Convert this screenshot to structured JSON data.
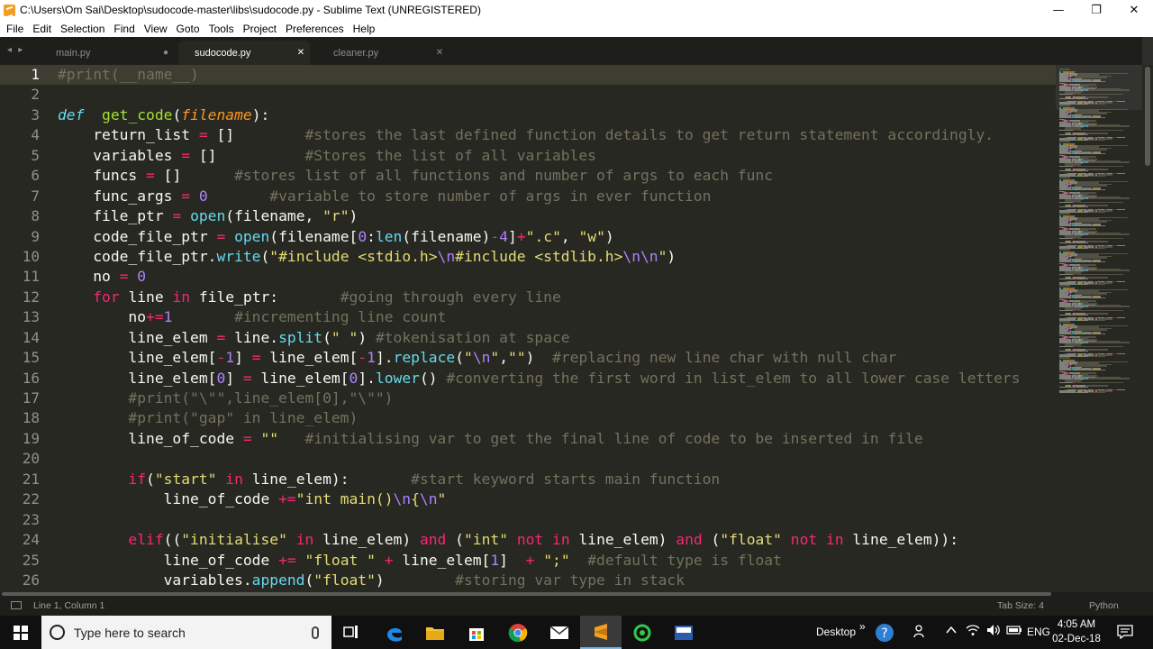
{
  "window": {
    "title": "C:\\Users\\Om Sai\\Desktop\\sudocode-master\\libs\\sudocode.py - Sublime Text (UNREGISTERED)",
    "controls": [
      "—",
      "❐",
      "✕"
    ]
  },
  "menu": [
    "File",
    "Edit",
    "Selection",
    "Find",
    "View",
    "Goto",
    "Tools",
    "Project",
    "Preferences",
    "Help"
  ],
  "tabs": [
    {
      "label": "main.py",
      "control": "●",
      "active": false
    },
    {
      "label": "sudocode.py",
      "control": "✕",
      "active": true
    },
    {
      "label": "cleaner.py",
      "control": "✕",
      "active": false
    }
  ],
  "tab_nav": "◂ ▸",
  "editor": {
    "line_numbers": [
      "1",
      "2",
      "3",
      "4",
      "5",
      "6",
      "7",
      "8",
      "9",
      "10",
      "11",
      "12",
      "13",
      "14",
      "15",
      "16",
      "17",
      "18",
      "19",
      "20",
      "21",
      "22",
      "23",
      "24",
      "25",
      "26"
    ],
    "current_line": 1,
    "lines": [
      [
        [
          "cm",
          "#print(__name__)"
        ]
      ],
      [],
      [
        [
          "kd",
          "def"
        ],
        [
          "",
          "  "
        ],
        [
          "fn",
          "get_code"
        ],
        [
          "",
          "("
        ],
        [
          "pm",
          "filename"
        ],
        [
          "",
          "):"
        ]
      ],
      [
        [
          "",
          "    return_list "
        ],
        [
          "kw",
          "="
        ],
        [
          "",
          " []        "
        ],
        [
          "cm",
          "#stores the last defined function details to get return statement accordingly."
        ]
      ],
      [
        [
          "",
          "    variables "
        ],
        [
          "kw",
          "="
        ],
        [
          "",
          " []          "
        ],
        [
          "cm",
          "#Stores the list of all variables"
        ]
      ],
      [
        [
          "",
          "    funcs "
        ],
        [
          "kw",
          "="
        ],
        [
          "",
          " []      "
        ],
        [
          "cm",
          "#stores list of all functions and number of args to each func"
        ]
      ],
      [
        [
          "",
          "    func_args "
        ],
        [
          "kw",
          "="
        ],
        [
          "",
          " "
        ],
        [
          "nm",
          "0"
        ],
        [
          "",
          "       "
        ],
        [
          "cm",
          "#variable to store number of args in ever function"
        ]
      ],
      [
        [
          "",
          "    file_ptr "
        ],
        [
          "kw",
          "="
        ],
        [
          "",
          " "
        ],
        [
          "bi",
          "open"
        ],
        [
          "",
          "(filename, "
        ],
        [
          "st",
          "\"r\""
        ],
        [
          "",
          ")"
        ]
      ],
      [
        [
          "",
          "    code_file_ptr "
        ],
        [
          "kw",
          "="
        ],
        [
          "",
          " "
        ],
        [
          "bi",
          "open"
        ],
        [
          "",
          "(filename["
        ],
        [
          "nm",
          "0"
        ],
        [
          "",
          ":"
        ],
        [
          "bi",
          "len"
        ],
        [
          "",
          "(filename)"
        ],
        [
          "kw",
          "-"
        ],
        [
          "nm",
          "4"
        ],
        [
          "",
          "]"
        ],
        [
          "kw",
          "+"
        ],
        [
          "st",
          "\".c\""
        ],
        [
          "",
          ", "
        ],
        [
          "st",
          "\"w\""
        ],
        [
          "",
          ")"
        ]
      ],
      [
        [
          "",
          "    code_file_ptr."
        ],
        [
          "bi",
          "write"
        ],
        [
          "",
          "("
        ],
        [
          "st",
          "\"#include <stdio.h>"
        ],
        [
          "es",
          "\\n"
        ],
        [
          "st",
          "#include <stdlib.h>"
        ],
        [
          "es",
          "\\n\\n"
        ],
        [
          "st",
          "\""
        ],
        [
          "",
          ")"
        ]
      ],
      [
        [
          "",
          "    no "
        ],
        [
          "kw",
          "="
        ],
        [
          "",
          " "
        ],
        [
          "nm",
          "0"
        ]
      ],
      [
        [
          "",
          "    "
        ],
        [
          "kw",
          "for"
        ],
        [
          "",
          " line "
        ],
        [
          "kw",
          "in"
        ],
        [
          "",
          " file_ptr:       "
        ],
        [
          "cm",
          "#going through every line"
        ]
      ],
      [
        [
          "",
          "        no"
        ],
        [
          "kw",
          "+="
        ],
        [
          "nm",
          "1"
        ],
        [
          "",
          "       "
        ],
        [
          "cm",
          "#incrementing line count"
        ]
      ],
      [
        [
          "",
          "        line_elem "
        ],
        [
          "kw",
          "="
        ],
        [
          "",
          " line."
        ],
        [
          "bi",
          "split"
        ],
        [
          "",
          "("
        ],
        [
          "st",
          "\" \""
        ],
        [
          "",
          ") "
        ],
        [
          "cm",
          "#tokenisation at space"
        ]
      ],
      [
        [
          "",
          "        line_elem["
        ],
        [
          "kw",
          "-"
        ],
        [
          "nm",
          "1"
        ],
        [
          "",
          "] "
        ],
        [
          "kw",
          "="
        ],
        [
          "",
          " line_elem["
        ],
        [
          "kw",
          "-"
        ],
        [
          "nm",
          "1"
        ],
        [
          "",
          "]."
        ],
        [
          "bi",
          "replace"
        ],
        [
          "",
          "("
        ],
        [
          "st",
          "\""
        ],
        [
          "es",
          "\\n"
        ],
        [
          "st",
          "\""
        ],
        [
          "",
          ","
        ],
        [
          "st",
          "\"\""
        ],
        [
          "",
          ")  "
        ],
        [
          "cm",
          "#replacing new line char with null char"
        ]
      ],
      [
        [
          "",
          "        line_elem["
        ],
        [
          "nm",
          "0"
        ],
        [
          "",
          "] "
        ],
        [
          "kw",
          "="
        ],
        [
          "",
          " line_elem["
        ],
        [
          "nm",
          "0"
        ],
        [
          "",
          "]."
        ],
        [
          "bi",
          "lower"
        ],
        [
          "",
          "() "
        ],
        [
          "cm",
          "#converting the first word in list_elem to all lower case letters"
        ]
      ],
      [
        [
          "",
          "        "
        ],
        [
          "cm",
          "#print(\"\\\"\",line_elem[0],\"\\\"\")"
        ]
      ],
      [
        [
          "",
          "        "
        ],
        [
          "cm",
          "#print(\"gap\" in line_elem)"
        ]
      ],
      [
        [
          "",
          "        line_of_code "
        ],
        [
          "kw",
          "="
        ],
        [
          "",
          " "
        ],
        [
          "st",
          "\"\""
        ],
        [
          "",
          "   "
        ],
        [
          "cm",
          "#initialising var to get the final line of code to be inserted in file"
        ]
      ],
      [],
      [
        [
          "",
          "        "
        ],
        [
          "kw",
          "if"
        ],
        [
          "",
          "("
        ],
        [
          "st",
          "\"start\""
        ],
        [
          "",
          " "
        ],
        [
          "kw",
          "in"
        ],
        [
          "",
          " line_elem):       "
        ],
        [
          "cm",
          "#start keyword starts main function"
        ]
      ],
      [
        [
          "",
          "            line_of_code "
        ],
        [
          "kw",
          "+="
        ],
        [
          "st",
          "\"int main()"
        ],
        [
          "es",
          "\\n"
        ],
        [
          "st",
          "{"
        ],
        [
          "es",
          "\\n"
        ],
        [
          "st",
          "\""
        ]
      ],
      [],
      [
        [
          "",
          "        "
        ],
        [
          "kw",
          "elif"
        ],
        [
          "",
          "(("
        ],
        [
          "st",
          "\"initialise\""
        ],
        [
          "",
          " "
        ],
        [
          "kw",
          "in"
        ],
        [
          "",
          " line_elem) "
        ],
        [
          "kw",
          "and"
        ],
        [
          "",
          " ("
        ],
        [
          "st",
          "\"int\""
        ],
        [
          "",
          " "
        ],
        [
          "kw",
          "not"
        ],
        [
          "",
          " "
        ],
        [
          "kw",
          "in"
        ],
        [
          "",
          " line_elem) "
        ],
        [
          "kw",
          "and"
        ],
        [
          "",
          " ("
        ],
        [
          "st",
          "\"float\""
        ],
        [
          "",
          " "
        ],
        [
          "kw",
          "not"
        ],
        [
          "",
          " "
        ],
        [
          "kw",
          "in"
        ],
        [
          "",
          " line_elem)):"
        ]
      ],
      [
        [
          "",
          "            line_of_code "
        ],
        [
          "kw",
          "+="
        ],
        [
          "",
          " "
        ],
        [
          "st",
          "\"float \""
        ],
        [
          "",
          " "
        ],
        [
          "kw",
          "+"
        ],
        [
          "",
          " line_elem["
        ],
        [
          "nm",
          "1"
        ],
        [
          "",
          "]  "
        ],
        [
          "kw",
          "+"
        ],
        [
          "",
          " "
        ],
        [
          "st",
          "\";\""
        ],
        [
          "",
          "  "
        ],
        [
          "cm",
          "#default type is float"
        ]
      ],
      [
        [
          "",
          "            variables."
        ],
        [
          "bi",
          "append"
        ],
        [
          "",
          "("
        ],
        [
          "st",
          "\"float\""
        ],
        [
          "",
          ")        "
        ],
        [
          "cm",
          "#storing var type in stack"
        ]
      ]
    ]
  },
  "status": {
    "position": "Line 1, Column 1",
    "tab_size": "Tab Size: 4",
    "syntax": "Python"
  },
  "taskbar": {
    "search_placeholder": "Type here to search",
    "icons": [
      "task-view-icon",
      "edge-icon",
      "file-explorer-icon",
      "store-icon",
      "chrome-icon",
      "mail-icon",
      "sublime-text-icon",
      "refresh-app-icon",
      "dev-cpp-icon"
    ],
    "desktop_label": "Desktop",
    "language": "ENG",
    "time": "4:05 AM",
    "date": "02-Dec-18",
    "chevron": "»"
  },
  "colors": {
    "background": "#272822",
    "keyword": "#f92672",
    "function": "#a6e22e",
    "builtin": "#66d9ef",
    "parameter": "#fd971f",
    "string": "#e6db74",
    "number": "#ae81ff",
    "comment": "#75715e"
  }
}
